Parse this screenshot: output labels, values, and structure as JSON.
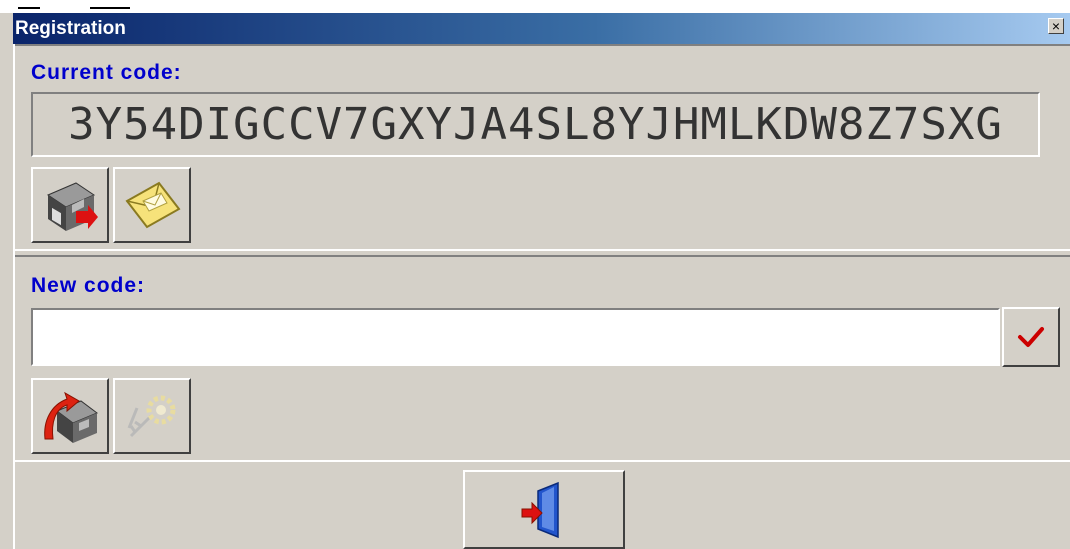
{
  "window": {
    "title": "Registration",
    "close_glyph": "×"
  },
  "current": {
    "label": "Current code:",
    "code": "3Y54DIGCCV7GXYJA4SL8YJHMLKDW8Z7SXG",
    "buttons": [
      {
        "icon": "save-disk-icon"
      },
      {
        "icon": "envelope-icon"
      }
    ]
  },
  "new": {
    "label": "New code:",
    "value": "",
    "placeholder": "",
    "confirm_icon": "checkmark-icon",
    "buttons": [
      {
        "icon": "load-disk-icon"
      },
      {
        "icon": "key-icon"
      }
    ]
  },
  "exit": {
    "icon": "exit-door-icon"
  },
  "colors": {
    "label_blue": "#0000cc",
    "face": "#d4d0c8",
    "title_start": "#0a246a",
    "title_end": "#a6caf0",
    "check_red": "#cc0000"
  }
}
